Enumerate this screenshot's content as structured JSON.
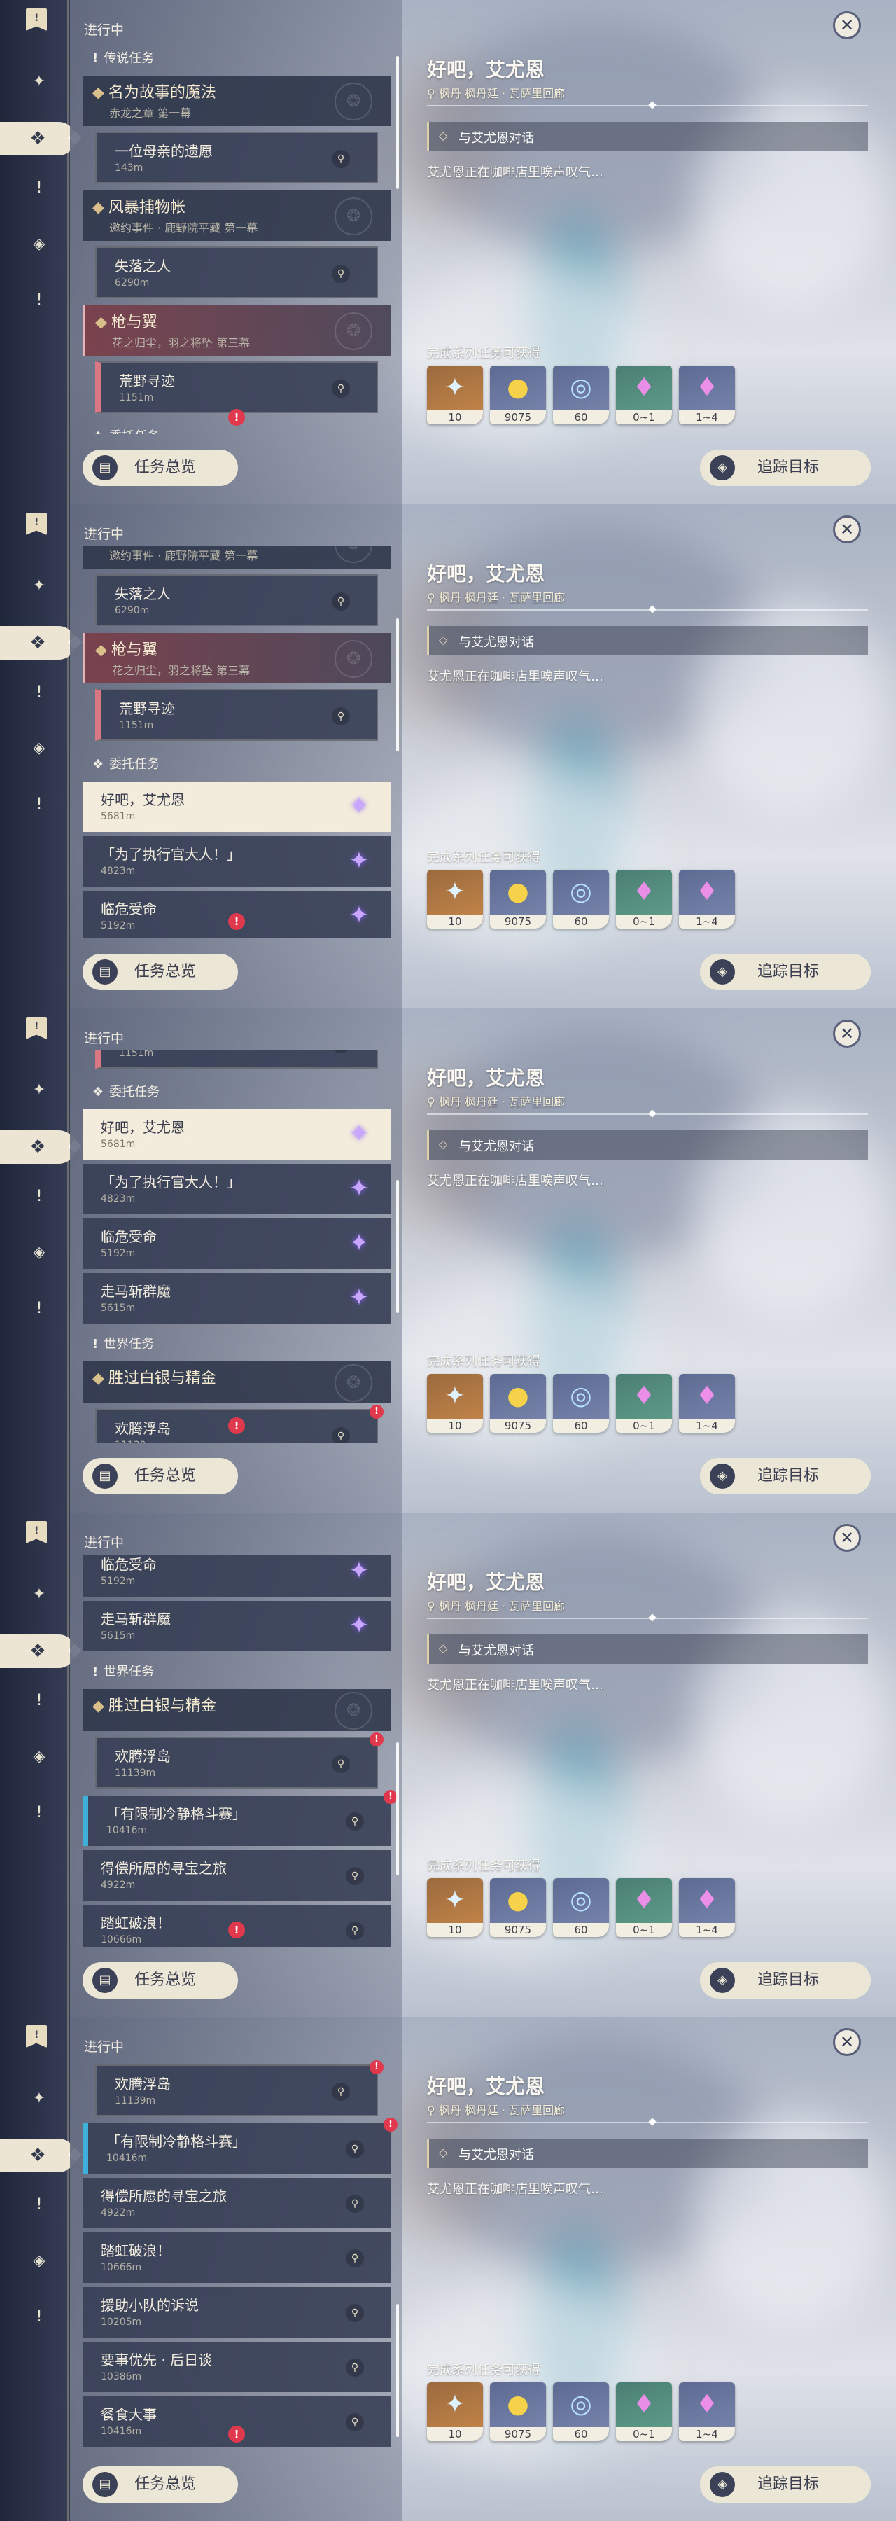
{
  "common": {
    "in_progress": "进行中",
    "overview_label": "任务总览",
    "track_label": "追踪目标",
    "close_symbol": "✕",
    "menu_symbol": "!",
    "categories": [
      "✦",
      "❖",
      "!",
      "◈",
      "!"
    ]
  },
  "detail": {
    "title": "好吧，艾尤恩",
    "location": "枫丹 枫丹廷 · 瓦萨里回廊",
    "objective": "与艾尤恩对话",
    "description": "艾尤恩正在咖啡店里唉声叹气…",
    "rewards_label": "完成系列任务可获得",
    "rewards": [
      {
        "icon": "✦",
        "icon_name": "primogem-icon",
        "count": "10"
      },
      {
        "icon": "●",
        "icon_name": "mora-icon",
        "count": "9075"
      },
      {
        "icon": "◎",
        "icon_name": "companionship-exp-icon",
        "count": "60"
      },
      {
        "icon": "♦",
        "icon_name": "crystal-icon",
        "count": "0~1"
      },
      {
        "icon": "♦",
        "icon_name": "crystal-ore-icon",
        "count": "1~4"
      }
    ]
  },
  "quest_list": {
    "legend_section": "传说任务",
    "legend_group": {
      "title": "名为故事的魔法",
      "subtitle": "赤龙之章 第一幕"
    },
    "q_mother": {
      "title": "一位母亲的遗愿",
      "dist": "143m"
    },
    "event_group": {
      "title": "风暴捕物帐",
      "subtitle": "邀约事件 · 鹿野院平藏 第一幕"
    },
    "q_lost": {
      "title": "失落之人",
      "dist": "6290m"
    },
    "gun_group": {
      "title": "枪与翼",
      "subtitle": "花之归尘，羽之将坠 第三幕"
    },
    "q_wild": {
      "title": "荒野寻迹",
      "dist": "1151m"
    },
    "commission_section": "委托任务",
    "q_okay": {
      "title": "好吧，艾尤恩",
      "dist": "5681m"
    },
    "q_exec": {
      "title": "「为了执行官大人！」",
      "dist": "4823m"
    },
    "q_danger": {
      "title": "临危受命",
      "dist": "5192m"
    },
    "q_horse": {
      "title": "走马斩群魔",
      "dist": "5615m"
    },
    "world_section": "世界任务",
    "silver_group": {
      "title": "胜过白银与精金"
    },
    "q_island": {
      "title": "欢腾浮岛",
      "dist": "11139m"
    },
    "q_fight": {
      "title": "「有限制冷静格斗赛」",
      "dist": "10416m"
    },
    "q_treasure": {
      "title": "得偿所愿的寻宝之旅",
      "dist": "4922m"
    },
    "q_rainbow": {
      "title": "踏虹破浪！",
      "dist": "10666m"
    },
    "q_rescue": {
      "title": "援助小队的诉说",
      "dist": "10205m"
    },
    "q_priority": {
      "title": "要事优先 · 后日谈",
      "dist": "10386m"
    },
    "q_meal": {
      "title": "餐食大事",
      "dist": "10416m"
    }
  },
  "panel_locations": [
    "枫丹 枫丹廷 · 瓦萨里回廊",
    "枫丹 枫丹廷 · 瓦萨里回廊",
    "枫丹 枫丹廷 · 瓦萨里回廊",
    "枫丹 枫丹廷 · 瓦萨里回廊",
    "枫丹 枫丹廷 · 瓦萨里回廊"
  ],
  "panel_selected_category": [
    1,
    1,
    1,
    1,
    1
  ],
  "panel_scroll_fraction": [
    0.0,
    0.25,
    0.5,
    0.75,
    1.0
  ]
}
